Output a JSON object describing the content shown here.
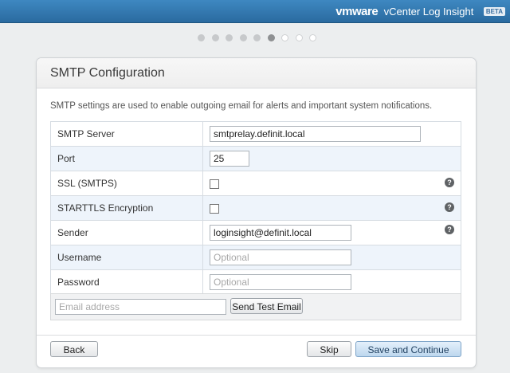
{
  "header": {
    "brand_logo": "vmware",
    "product": "vCenter Log Insight",
    "badge": "BETA"
  },
  "wizard": {
    "total_steps": 9,
    "current_step": 6
  },
  "panel": {
    "title": "SMTP Configuration",
    "description": "SMTP settings are used to enable outgoing email for alerts and important system notifications."
  },
  "form": {
    "smtp_server": {
      "label": "SMTP Server",
      "value": "smtprelay.definit.local"
    },
    "port": {
      "label": "Port",
      "value": "25"
    },
    "ssl": {
      "label": "SSL (SMTPS)",
      "checked": false,
      "help_icon": "question-circle-icon"
    },
    "starttls": {
      "label": "STARTTLS Encryption",
      "checked": false,
      "help_icon": "question-circle-icon"
    },
    "sender": {
      "label": "Sender",
      "value": "loginsight@definit.local",
      "help_icon": "question-circle-icon"
    },
    "username": {
      "label": "Username",
      "value": "",
      "placeholder": "Optional"
    },
    "password": {
      "label": "Password",
      "value": "",
      "placeholder": "Optional"
    }
  },
  "test_email": {
    "placeholder": "Email address",
    "button_label": "Send Test Email"
  },
  "footer": {
    "back_label": "Back",
    "skip_label": "Skip",
    "continue_label": "Save and Continue"
  },
  "help_glyph": "?",
  "colors": {
    "header_blue": "#2f75ad",
    "row_alt": "#eef4fb",
    "primary_button": "#bdd7ee"
  }
}
